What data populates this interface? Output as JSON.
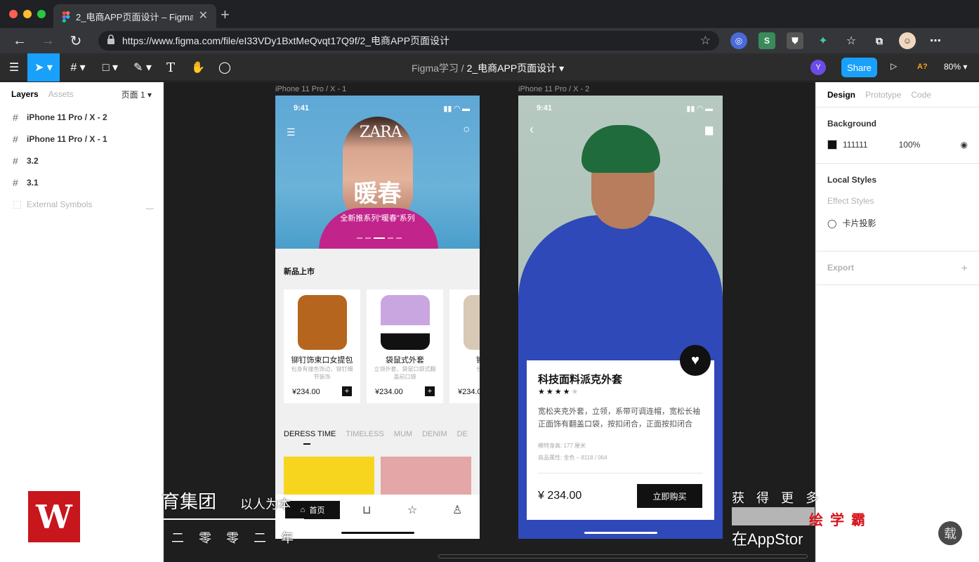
{
  "browser": {
    "tab_title": "2_电商APP页面设计 – Figma",
    "url": "https://www.figma.com/file/eI33VDy1BxtMeQvqt17Q9f/2_电商APP页面设计"
  },
  "figma": {
    "breadcrumb_team": "Figma学习",
    "breadcrumb_sep": "/",
    "file_name": "2_电商APP页面设计",
    "user_initial": "Y",
    "share_label": "Share",
    "missing_fonts": "A?",
    "zoom": "80%"
  },
  "left_panel": {
    "tab_layers": "Layers",
    "tab_assets": "Assets",
    "page": "页面 1",
    "layers": [
      "iPhone 11 Pro / X - 2",
      "iPhone 11 Pro / X - 1",
      "3.2",
      "3.1"
    ],
    "external": "External Symbols"
  },
  "canvas": {
    "frame1_label": "iPhone 11 Pro / X - 1",
    "frame2_label": "iPhone 11 Pro / X - 2"
  },
  "frame1": {
    "time": "9:41",
    "brand": "ZARA",
    "hero_title": "暖春",
    "hero_sub": "全新推系列“暖春”系列",
    "section_title": "新品上市",
    "cards": [
      {
        "name": "铆钉饰束口女提包",
        "desc": "包身有撞色饰边，铆钉细节装饰",
        "price": "¥234.00"
      },
      {
        "name": "袋鼠式外套",
        "desc": "立领外套，袋鼠口袋式翻盖前口袋",
        "price": "¥234.00"
      },
      {
        "name": "铆钉饰",
        "desc": "包身有撞",
        "price": "¥234.0"
      }
    ],
    "categories": [
      "DERESS TIME",
      "TIMELESS",
      "MUM",
      "DENIM",
      "DE"
    ],
    "nav_home": "首页"
  },
  "frame2": {
    "time": "9:41",
    "product_title": "科技面料派克外套",
    "desc": "宽松夹克外套，立领，系带可调连帽，宽松长袖正面饰有翻盖口袋，按扣闭合，正面按扣闭合",
    "model_height": "模特身高: 177 厘米",
    "attributes": "商品属性: 金色 – 8118 / 064",
    "price": "¥ 234.00",
    "buy_label": "立即购买",
    "rating": 4
  },
  "right_panel": {
    "tab_design": "Design",
    "tab_prototype": "Prototype",
    "tab_code": "Code",
    "bg_heading": "Background",
    "bg_hex": "111111",
    "bg_opacity": "100%",
    "local_styles": "Local Styles",
    "effect_styles": "Effect Styles",
    "effect_name": "卡片投影",
    "export": "Export"
  },
  "overlay": {
    "left_text": "育集团",
    "slogan": "以人为本",
    "year": "二 零 零 二 年",
    "right_text": "获 得 更 多",
    "red_text": "绘学霸",
    "appstore": "在AppStor",
    "corner": "载"
  },
  "colors": {
    "accent": "#18a0fb",
    "canvas_bg": "#1e1e1e",
    "brand_red": "#c8161d"
  }
}
